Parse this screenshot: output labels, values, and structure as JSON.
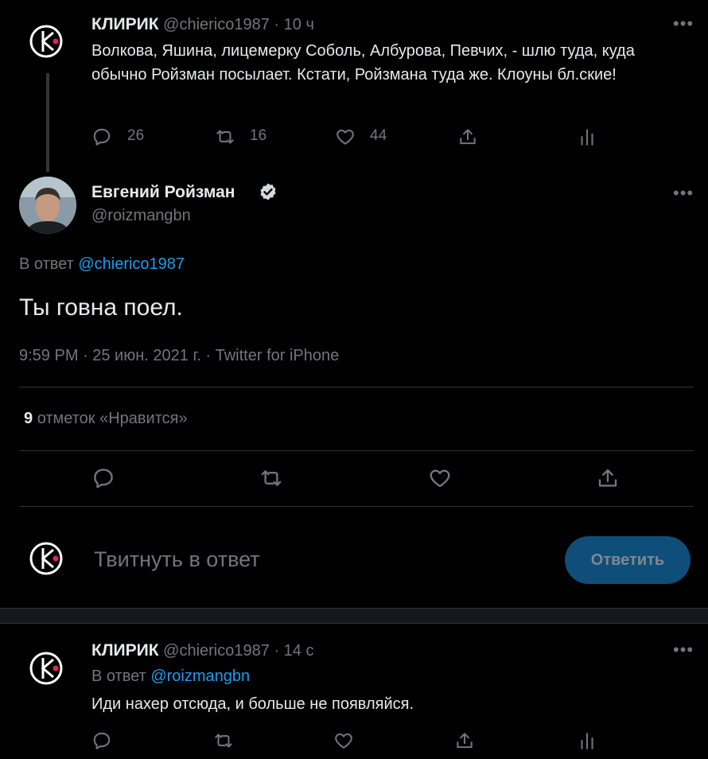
{
  "tweet1": {
    "display_name": "КЛИРИК",
    "handle": "@chierico1987",
    "sep": "·",
    "time": "10 ч",
    "text": "Волкова, Яшина, лицемерку Соболь, Албурова, Певчих, - шлю туда, куда обычно Ройзман посылает. Кстати, Ройзмана туда же. Клоуны бл.ские!",
    "replies": "26",
    "retweets": "16",
    "likes": "44"
  },
  "main_tweet": {
    "display_name": "Евгений Ройзман",
    "handle": "@roizmangbn",
    "reply_prefix": "В ответ",
    "reply_to": "@chierico1987",
    "text": "Ты говна поел.",
    "meta": "9:59 PM · 25 июн. 2021 г. · Twitter for iPhone",
    "likes_count": "9",
    "likes_label": "отметок «Нравится»"
  },
  "compose": {
    "placeholder": "Твитнуть в ответ",
    "button_label": "Ответить"
  },
  "tweet3": {
    "display_name": "КЛИРИК",
    "handle": "@chierico1987",
    "sep": "·",
    "time": "14 с",
    "reply_prefix": "В ответ",
    "reply_to": "@roizmangbn",
    "text": "Иди нахер отсюда, и больше не появляйся."
  },
  "more_glyph": "•••",
  "colors": {
    "background": "#000000",
    "text": "#e7e9ea",
    "muted": "#71767b",
    "link": "#1d9bf0",
    "divider": "#2f3336",
    "button_bg": "#0f4e78",
    "button_text": "#808890"
  }
}
